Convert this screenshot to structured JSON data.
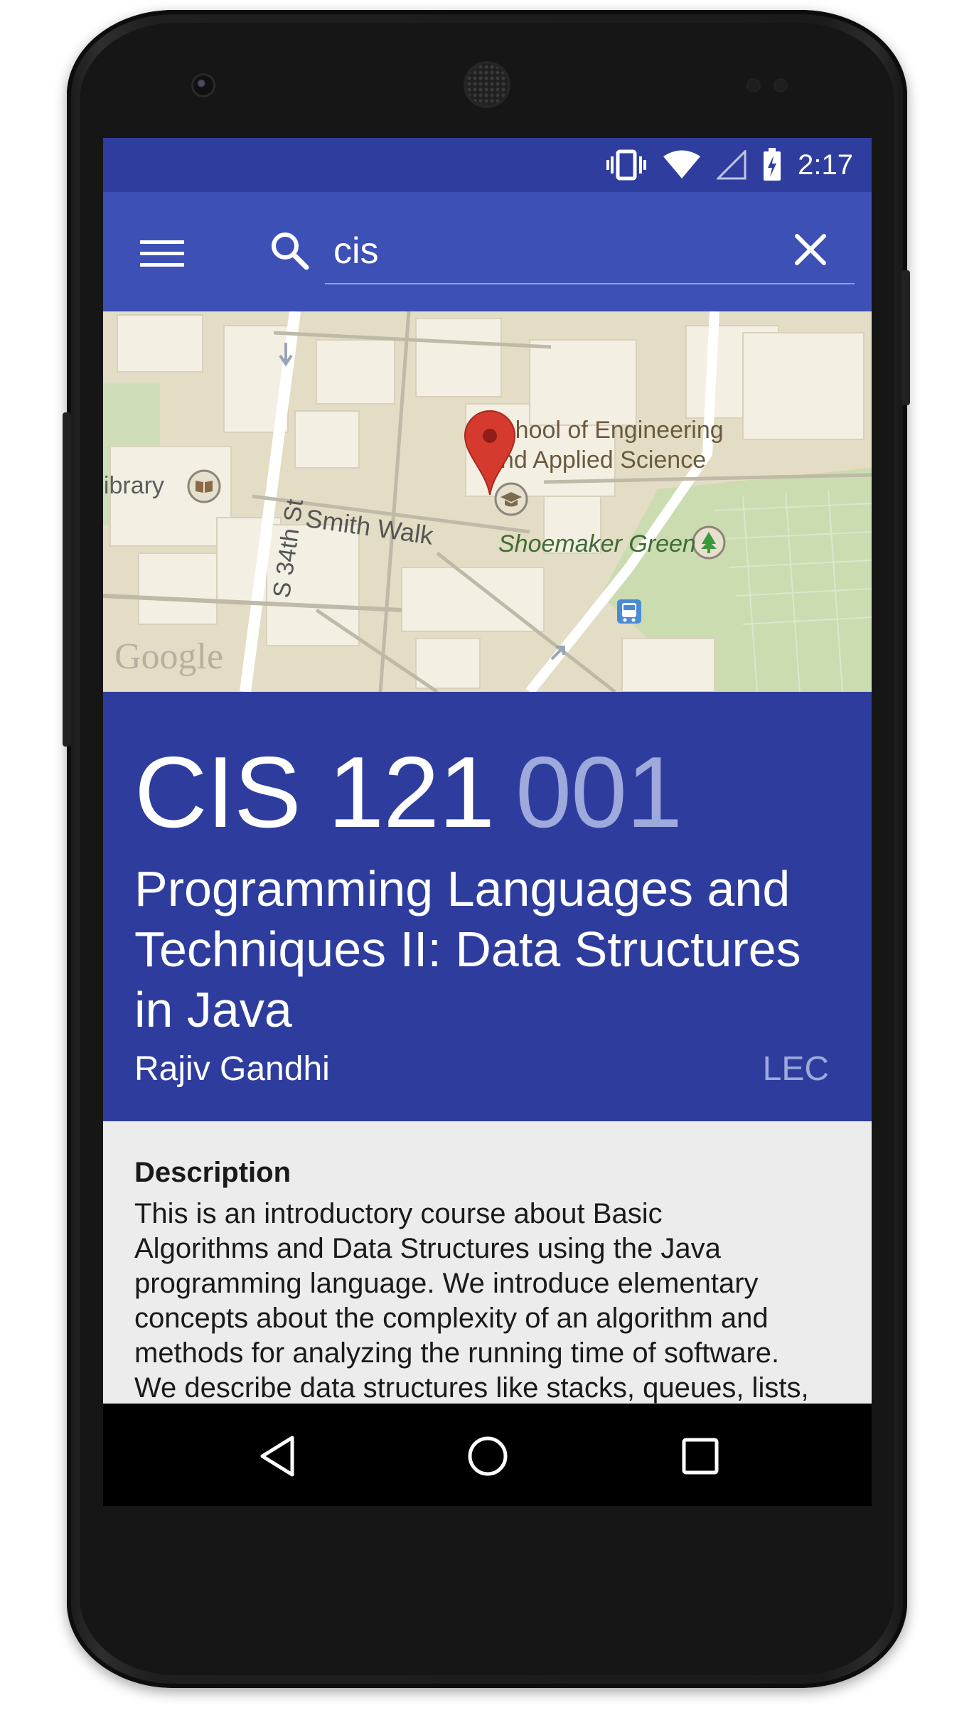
{
  "status_bar": {
    "time": "2:17",
    "icons": [
      "vibrate-icon",
      "wifi-icon",
      "cell-signal-icon",
      "battery-charging-icon"
    ]
  },
  "toolbar": {
    "menu_icon": "menu-icon",
    "search_icon": "search-icon",
    "search_query": "cis",
    "clear_icon": "close-icon"
  },
  "map": {
    "labels": {
      "library": "Library",
      "school": "School of Engineering",
      "school_line2": "and Applied Science",
      "smith_walk": "Smith Walk",
      "street": "S 34th St",
      "shoemaker": "Shoemaker Green",
      "logo": "Google"
    },
    "icons": [
      "map-pin-icon",
      "book-icon",
      "graduation-cap-icon",
      "tree-icon",
      "bus-icon",
      "one-way-arrow-icon"
    ]
  },
  "course": {
    "code": "CIS 121",
    "section": "001",
    "title": "Programming Languages and Techniques II: Data Structures in Java",
    "instructor": "Rajiv Gandhi",
    "type": "LEC"
  },
  "description": {
    "heading": "Description",
    "lines": [
      "This is an introductory course about Basic",
      "Algorithms and Data Structures using the Java",
      "programming language. We introduce elementary",
      "concepts about the complexity of an algorithm and",
      "methods for analyzing the running time of software.",
      "We describe data structures like stacks, queues, lists,"
    ]
  },
  "nav_bar": {
    "icons": [
      "back-icon",
      "home-icon",
      "recents-icon"
    ]
  },
  "colors": {
    "status_bar": "#2f3e9e",
    "toolbar": "#3d50b6",
    "course_header": "#2e3d9d",
    "section_accent": "#9ea9dc",
    "content_bg": "#ececec"
  }
}
